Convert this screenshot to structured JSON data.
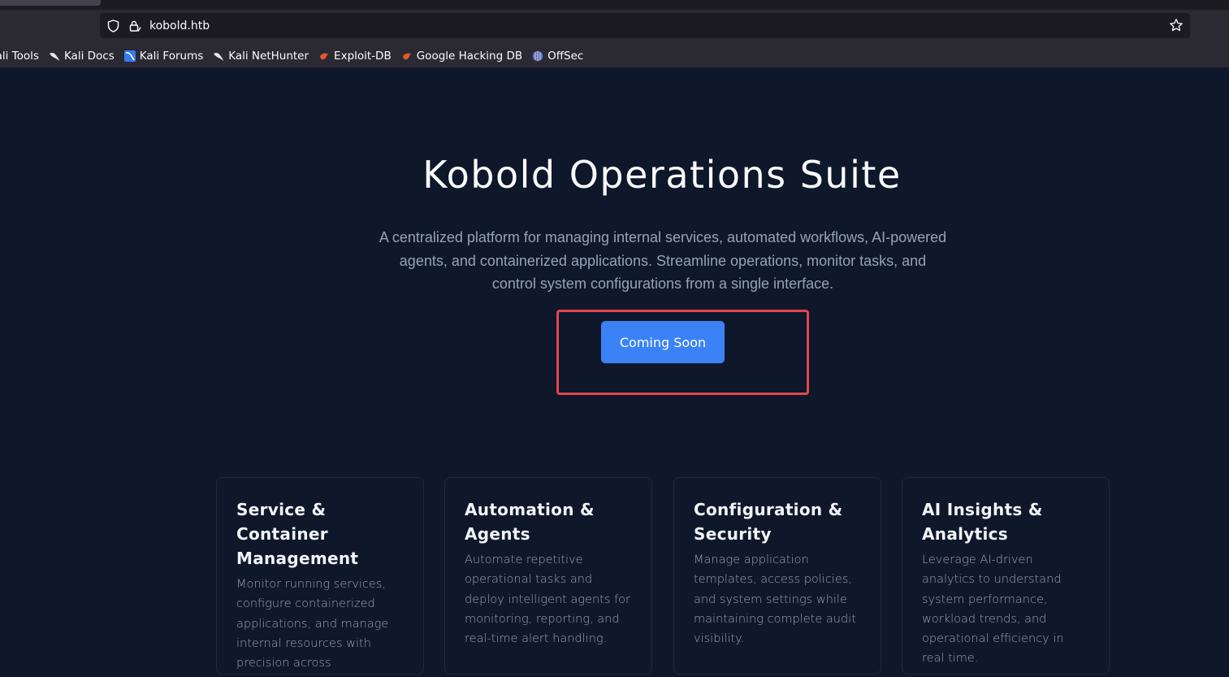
{
  "browser": {
    "url": "kobold.htb",
    "bookmarks": [
      {
        "label": "Kali Tools",
        "icon": "kali-dragon-icon"
      },
      {
        "label": "Kali Docs",
        "icon": "kali-dragon-icon"
      },
      {
        "label": "Kali Forums",
        "icon": "kali-forums-icon"
      },
      {
        "label": "Kali NetHunter",
        "icon": "kali-dragon-icon"
      },
      {
        "label": "Exploit-DB",
        "icon": "exploit-db-icon"
      },
      {
        "label": "Google Hacking DB",
        "icon": "exploit-db-icon"
      },
      {
        "label": "OffSec",
        "icon": "offsec-icon"
      }
    ]
  },
  "hero": {
    "title": "Kobold Operations Suite",
    "description": "A centralized platform for managing internal services, automated workflows, AI-powered agents, and containerized applications. Streamline operations, monitor tasks, and control system configurations from a single interface.",
    "cta_label": "Coming Soon"
  },
  "features": [
    {
      "title": "Service & Container Management",
      "text": "Monitor running services, configure containerized applications, and manage internal resources with precision across environments."
    },
    {
      "title": "Automation & Agents",
      "text": "Automate repetitive operational tasks and deploy intelligent agents for monitoring, reporting, and real-time alert handling."
    },
    {
      "title": "Configuration & Security",
      "text": "Manage application templates, access policies, and system settings while maintaining complete audit visibility."
    },
    {
      "title": "AI Insights & Analytics",
      "text": "Leverage AI-driven analytics to understand system performance, workload trends, and operational efficiency in real time."
    }
  ],
  "colors": {
    "page_bg": "#0f172a",
    "accent": "#3b82f6",
    "highlight_border": "#e0474c"
  }
}
